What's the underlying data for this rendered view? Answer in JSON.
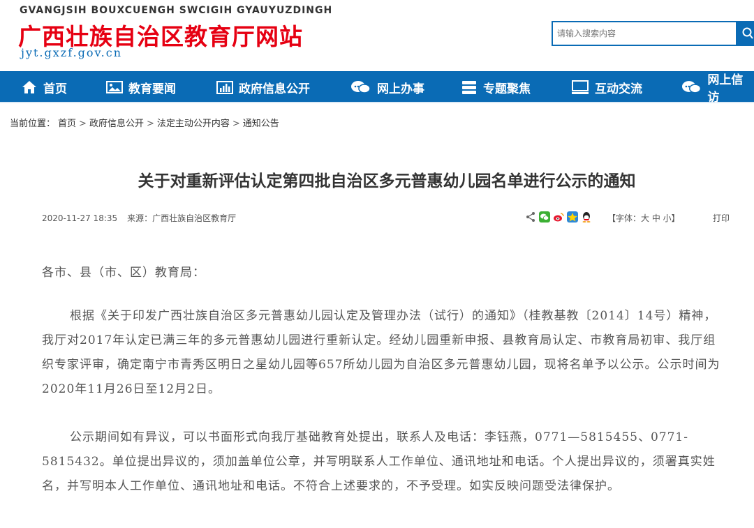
{
  "header": {
    "site_en": "GVANGJSIH BOUXCUENGH SWCIGIH GYAUYUZDINGH",
    "site_cn": "广西壮族自治区教育厅网站",
    "site_url": "jyt.gxzf.gov.cn",
    "search_placeholder": "请输入搜索内容"
  },
  "nav": {
    "items": [
      {
        "label": "首页",
        "icon": "home-icon"
      },
      {
        "label": "教育要闻",
        "icon": "image-icon"
      },
      {
        "label": "政府信息公开",
        "icon": "bar-chart-icon"
      },
      {
        "label": "网上办事",
        "icon": "chat-bubbles-icon"
      },
      {
        "label": "专题聚焦",
        "icon": "stack-icon"
      },
      {
        "label": "互动交流",
        "icon": "monitor-icon"
      },
      {
        "label": "网上信访",
        "icon": "chat-bubbles-icon"
      }
    ]
  },
  "breadcrumb": {
    "prefix": "当前位置：",
    "items": [
      "首页",
      "政府信息公开",
      "法定主动公开内容",
      "通知公告"
    ],
    "separator": ">"
  },
  "article": {
    "title": "关于对重新评估认定第四批自治区多元普惠幼儿园名单进行公示的通知",
    "date": "2020-11-27 18:35",
    "source": "来源：广西壮族自治区教育厅",
    "font_label": "【字体：大 中 小】",
    "print_label": "打印",
    "greeting": "各市、县（市、区）教育局：",
    "paragraph1": "根据《关于印发广西壮族自治区多元普惠幼儿园认定及管理办法（试行）的通知》（桂教基教〔2014〕14号）精神，我厅对2017年认定已满三年的多元普惠幼儿园进行重新认定。经幼儿园重新申报、县教育局认定、市教育局初审、我厅组织专家评审，确定南宁市青秀区明日之星幼儿园等657所幼儿园为自治区多元普惠幼儿园，现将名单予以公示。公示时间为2020年11月26日至12月2日。",
    "paragraph2": "公示期间如有异议，可以书面形式向我厅基础教育处提出，联系人及电话：李钰燕，0771—5815455、0771-5815432。单位提出异议的，须加盖单位公章，并写明联系人工作单位、通讯地址和电话。个人提出异议的，须署真实姓名，并写明本人工作单位、通讯地址和电话。不符合上述要求的，不予受理。如实反映问题受法律保护。"
  },
  "share_icons": [
    "share-icon",
    "wechat-icon",
    "weibo-icon",
    "qzone-icon",
    "qq-icon"
  ],
  "colors": {
    "brand_blue": "#0a6bb5",
    "brand_red": "#e60012"
  }
}
